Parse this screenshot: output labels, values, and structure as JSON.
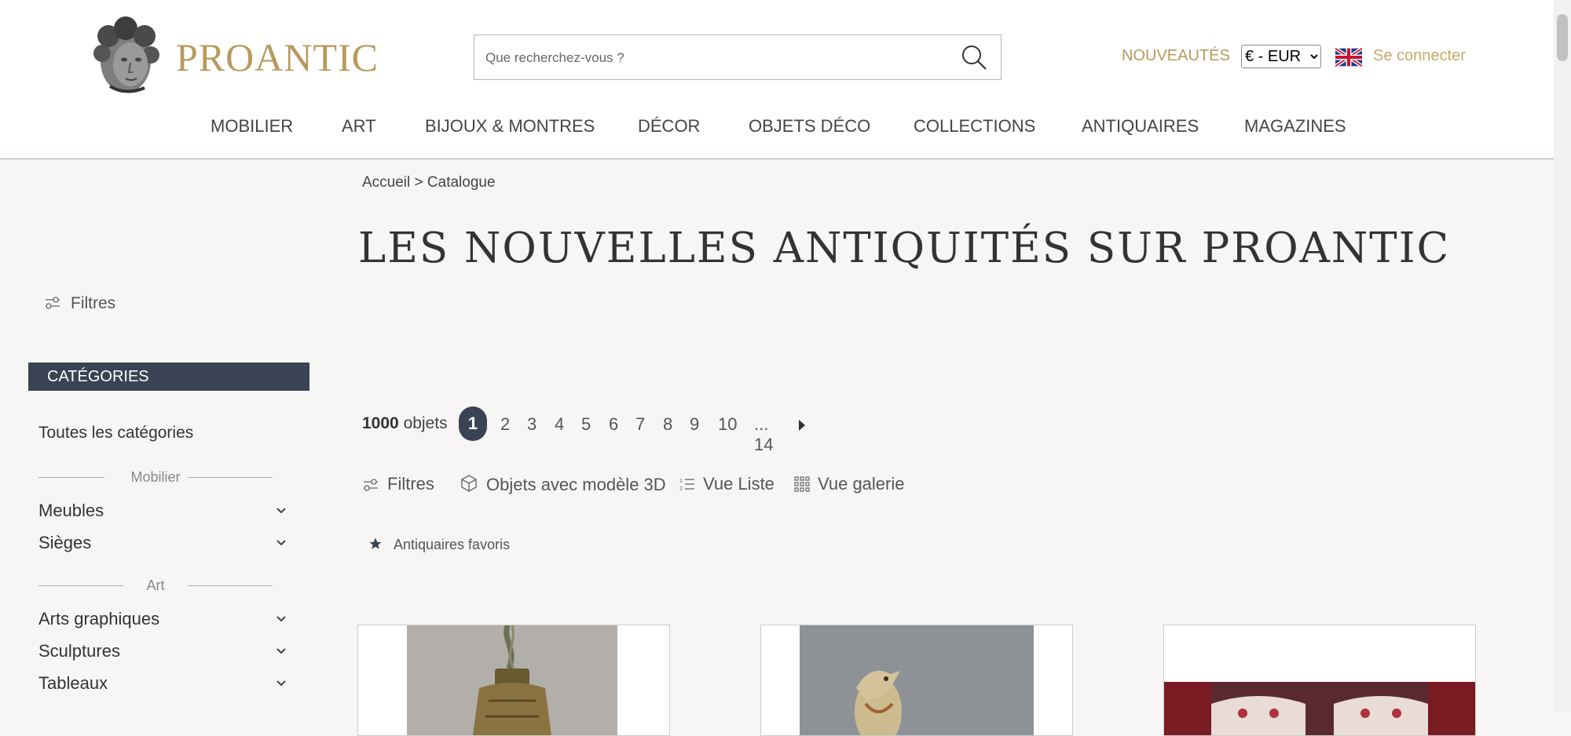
{
  "header": {
    "brand": "PROANTIC",
    "search_placeholder": "Que recherchez-vous ?",
    "nouveautes": "NOUVEAUTÉS",
    "currency": "€ - EUR",
    "login": "Se connecter"
  },
  "nav": [
    "MOBILIER",
    "ART",
    "BIJOUX & MONTRES",
    "DÉCOR",
    "OBJETS DÉCO",
    "COLLECTIONS",
    "ANTIQUAIRES",
    "MAGAZINES"
  ],
  "breadcrumb": {
    "home": "Accueil",
    "sep": " > ",
    "current": "Catalogue"
  },
  "page_title": "LES NOUVELLES ANTIQUITÉS SUR PROANTIC",
  "sidebar": {
    "filtres": "Filtres",
    "categories_header": "CATÉGORIES",
    "all_categories": "Toutes les catégories",
    "group_mobilier": "Mobilier",
    "mobilier_items": [
      "Meubles",
      "Sièges"
    ],
    "group_art": "Art",
    "art_items": [
      "Arts graphiques",
      "Sculptures",
      "Tableaux"
    ]
  },
  "results": {
    "count": "1000",
    "count_suffix": "objets",
    "pages": [
      "1",
      "2",
      "3",
      "4",
      "5",
      "6",
      "7",
      "8",
      "9",
      "10"
    ],
    "ellipsis_last": "... 14"
  },
  "toolbar": {
    "filtres": "Filtres",
    "objets_3d": "Objets avec modèle 3D",
    "vue_liste": "Vue Liste",
    "vue_galerie": "Vue galerie"
  },
  "favorites": "Antiquaires favoris",
  "colors": {
    "accent_gold": "#b89a5c",
    "navy": "#3a4354",
    "background": "#f7f6f4"
  }
}
